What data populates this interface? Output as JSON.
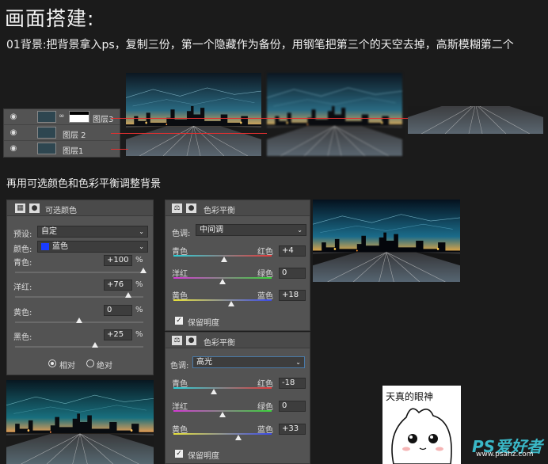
{
  "title": "画面搭建:",
  "intro": "01背景:把背景拿入ps，复制三份，第一个隐藏作为备份，用钢笔把第三个的天空去掉，高斯模糊第二个",
  "layers_panel": {
    "rows": [
      {
        "name": "图层3"
      },
      {
        "name": "图层 2"
      },
      {
        "name": "图层1"
      }
    ]
  },
  "subtitle": "再用可选颜色和色彩平衡调整背景",
  "selective_color": {
    "title": "可选颜色",
    "preset_label": "预设:",
    "preset_value": "自定",
    "colors_label": "颜色:",
    "colors_value": "蓝色",
    "sliders": [
      {
        "label": "青色:",
        "value": "+100",
        "unit": "%",
        "position": 1.0
      },
      {
        "label": "洋红:",
        "value": "+76",
        "unit": "%",
        "position": 0.88
      },
      {
        "label": "黄色:",
        "value": "0",
        "unit": "%",
        "position": 0.5
      },
      {
        "label": "黑色:",
        "value": "+25",
        "unit": "%",
        "position": 0.625
      }
    ],
    "radio_relative": "相对",
    "radio_absolute": "绝对"
  },
  "color_balance_mid": {
    "title": "色彩平衡",
    "tone_label": "色调:",
    "tone_value": "中间调",
    "sliders": [
      {
        "left": "青色",
        "right": "红色",
        "value": "+4",
        "position": 0.52
      },
      {
        "left": "洋红",
        "right": "绿色",
        "value": "0",
        "position": 0.5
      },
      {
        "left": "黄色",
        "right": "蓝色",
        "value": "+18",
        "position": 0.59
      }
    ],
    "preserve": "保留明度"
  },
  "color_balance_high": {
    "title": "色彩平衡",
    "tone_label": "色调:",
    "tone_value": "高光",
    "sliders": [
      {
        "left": "青色",
        "right": "红色",
        "value": "-18",
        "position": 0.41
      },
      {
        "left": "洋红",
        "right": "绿色",
        "value": "0",
        "position": 0.5
      },
      {
        "left": "黄色",
        "right": "蓝色",
        "value": "+33",
        "position": 0.665
      }
    ],
    "preserve": "保留明度"
  },
  "sticker_caption": "天真的眼神",
  "watermark": "PS爱好者",
  "watermark_url": "www.psahz.com",
  "colors": {
    "background": "#1b1b1b",
    "panel": "#535353",
    "accent_line": "#e03030",
    "watermark": "#3ab8c7"
  }
}
